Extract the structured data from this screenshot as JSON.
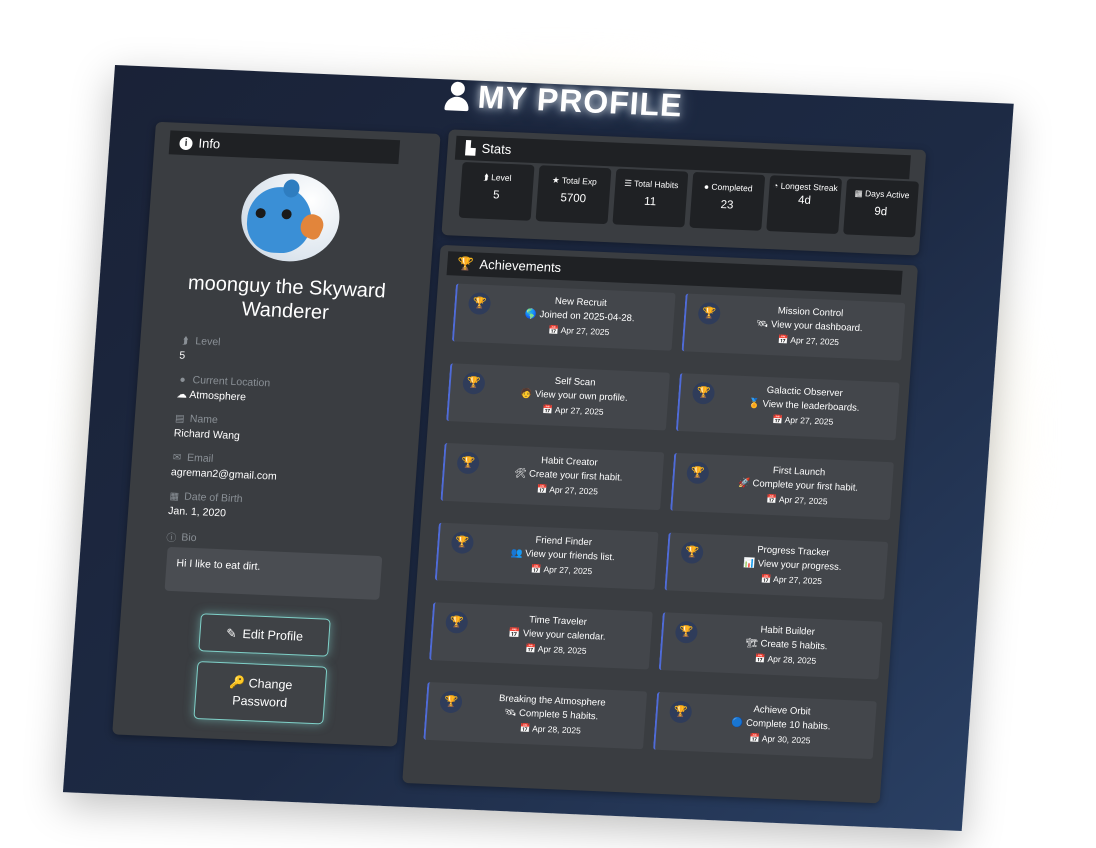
{
  "title": "MY PROFILE",
  "colors": {
    "accent": "#7fd0c8",
    "achievement_border": "#4f6bd8",
    "panel": "#3a3d41",
    "header": "#1f2124"
  },
  "info": {
    "header": "Info",
    "username": "moonguy the Skyward Wanderer",
    "fields": [
      {
        "label": "Level",
        "value": "5",
        "icon": "arrow-up-icon"
      },
      {
        "label": "Current Location",
        "value": "☁ Atmosphere",
        "icon": "map-pin-icon"
      },
      {
        "label": "Name",
        "value": "Richard Wang",
        "icon": "id-card-icon"
      },
      {
        "label": "Email",
        "value": "agreman2@gmail.com",
        "icon": "envelope-icon"
      },
      {
        "label": "Date of Birth",
        "value": "Jan. 1, 2020",
        "icon": "calendar-icon"
      },
      {
        "label": "Bio",
        "value": "",
        "icon": "info-icon"
      }
    ],
    "bio": "Hi I like to eat dirt.",
    "edit_button": "Edit Profile",
    "password_button_line1": "Change",
    "password_button_line2": "Password"
  },
  "stats": {
    "header": "Stats",
    "items": [
      {
        "label": "Level",
        "value": "5",
        "icon": "arrow-up-icon"
      },
      {
        "label": "Total Exp",
        "value": "5700",
        "icon": "star-icon"
      },
      {
        "label": "Total Habits",
        "value": "11",
        "icon": "list-icon"
      },
      {
        "label": "Completed",
        "value": "23",
        "icon": "check-circle-icon"
      },
      {
        "label": "Longest Streak",
        "value": "4d",
        "icon": "streak-icon"
      },
      {
        "label": "Days Active",
        "value": "9d",
        "icon": "calendar-icon"
      }
    ]
  },
  "achievements": {
    "header": "Achievements",
    "items": [
      {
        "title": "New Recruit",
        "desc": "🌎 Joined on 2025-04-28.",
        "date": "📅 Apr 27, 2025"
      },
      {
        "title": "Mission Control",
        "desc": "🛰 View your dashboard.",
        "date": "📅 Apr 27, 2025"
      },
      {
        "title": "Self Scan",
        "desc": "🧑 View your own profile.",
        "date": "📅 Apr 27, 2025"
      },
      {
        "title": "Galactic Observer",
        "desc": "🏅 View the leaderboards.",
        "date": "📅 Apr 27, 2025"
      },
      {
        "title": "Habit Creator",
        "desc": "🛠 Create your first habit.",
        "date": "📅 Apr 27, 2025"
      },
      {
        "title": "First Launch",
        "desc": "🚀 Complete your first habit.",
        "date": "📅 Apr 27, 2025"
      },
      {
        "title": "Friend Finder",
        "desc": "👥 View your friends list.",
        "date": "📅 Apr 27, 2025"
      },
      {
        "title": "Progress Tracker",
        "desc": "📊 View your progress.",
        "date": "📅 Apr 27, 2025"
      },
      {
        "title": "Time Traveler",
        "desc": "📅 View your calendar.",
        "date": "📅 Apr 28, 2025"
      },
      {
        "title": "Habit Builder",
        "desc": "🏗 Create 5 habits.",
        "date": "📅 Apr 28, 2025"
      },
      {
        "title": "Breaking the Atmosphere",
        "desc": "🛰 Complete 5 habits.",
        "date": "📅 Apr 28, 2025"
      },
      {
        "title": "Achieve Orbit",
        "desc": "🔵 Complete 10 habits.",
        "date": "📅 Apr 30, 2025"
      }
    ]
  }
}
